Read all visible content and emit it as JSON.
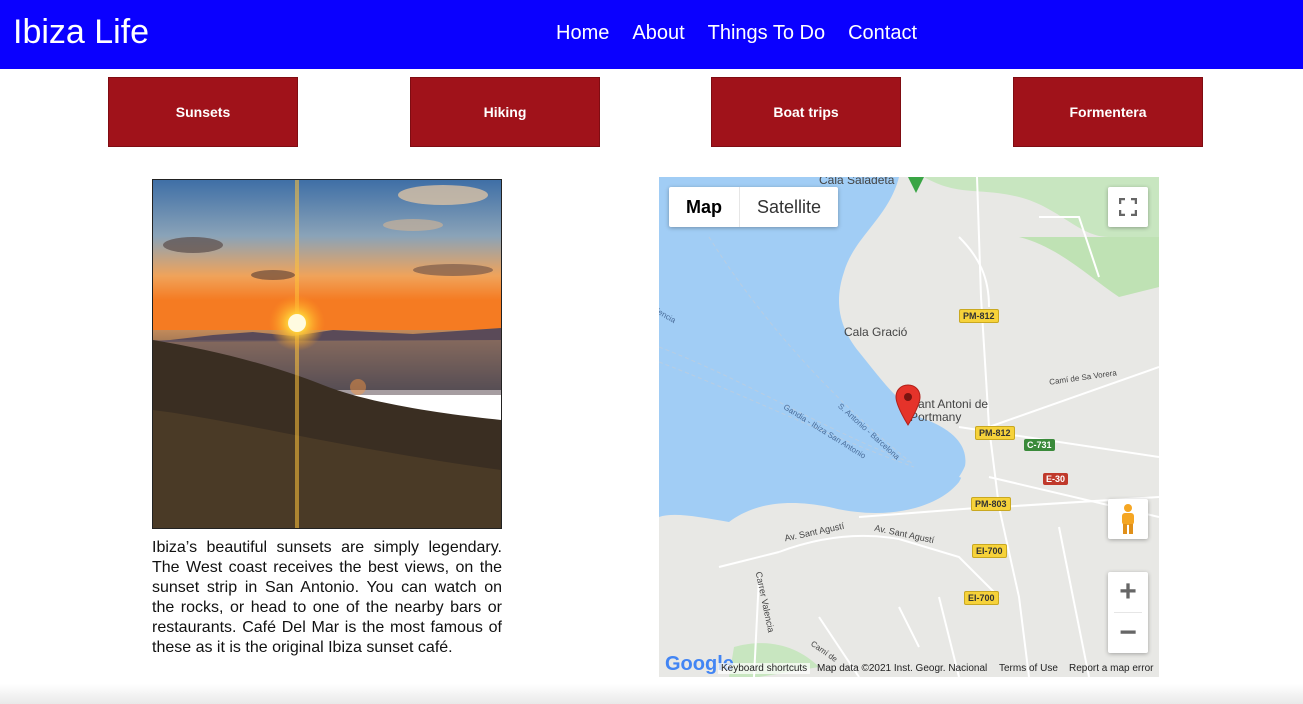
{
  "header": {
    "title": "Ibiza Life",
    "nav": [
      "Home",
      "About",
      "Things To Do",
      "Contact"
    ]
  },
  "categories": [
    "Sunsets",
    "Hiking",
    "Boat trips",
    "Formentera"
  ],
  "article": {
    "text": "Ibiza’s beautiful sunsets are simply legendary. The West coast receives the best views, on the sunset strip in San Antonio. You can watch on the rocks, or head to one of the nearby bars or restaurants. Café Del Mar is the most famous of these as it is the original Ibiza sunset café."
  },
  "map": {
    "type_buttons": [
      "Map",
      "Satellite"
    ],
    "place_labels": [
      "Cala Saladeta",
      "Cala Gració",
      "Sant Antoni de Portmany",
      "Av. Sant Agustí",
      "Av. Sant Agustí",
      "Carrer Valencia",
      "Gandia - Ibiza San Antonio",
      "S. Antonio - Barcelona",
      "Camí de Sa Vorera",
      "Valencia",
      "Camí de"
    ],
    "road_shields": [
      {
        "label": "PM-812",
        "style": "yellow"
      },
      {
        "label": "PM-812",
        "style": "yellow"
      },
      {
        "label": "C-731",
        "style": "green"
      },
      {
        "label": "E-30",
        "style": "red"
      },
      {
        "label": "PM-803",
        "style": "yellow"
      },
      {
        "label": "EI-700",
        "style": "yellow"
      },
      {
        "label": "EI-700",
        "style": "yellow"
      }
    ],
    "attribution": {
      "logo": "Google",
      "shortcuts": "Keyboard shortcuts",
      "data": "Map data ©2021 Inst. Geogr. Nacional",
      "terms": "Terms of Use",
      "report": "Report a map error"
    },
    "zoom_in": "+",
    "zoom_out": "−"
  },
  "colors": {
    "header_bg": "#0a00ff",
    "category_bg": "#a0121a",
    "water": "#a1cdf5",
    "land": "#e8e8e5"
  },
  "icons": [
    "fullscreen-icon",
    "pegman-icon",
    "map-pin-icon",
    "green-place-pin-icon"
  ]
}
